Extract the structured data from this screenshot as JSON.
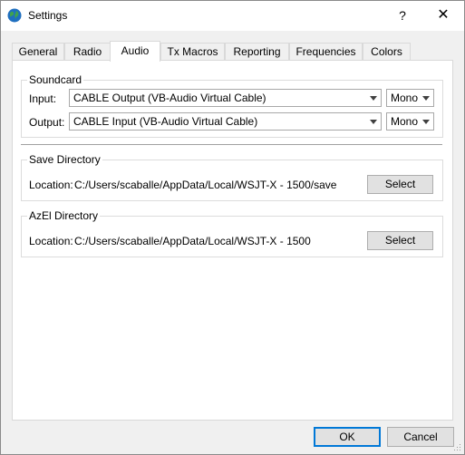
{
  "window": {
    "title": "Settings",
    "help_label": "?",
    "close_label": "✕",
    "icon": "wsjt-globe-icon"
  },
  "tabs": [
    {
      "label": "General",
      "active": false
    },
    {
      "label": "Radio",
      "active": false
    },
    {
      "label": "Audio",
      "active": true
    },
    {
      "label": "Tx Macros",
      "active": false
    },
    {
      "label": "Reporting",
      "active": false
    },
    {
      "label": "Frequencies",
      "active": false
    },
    {
      "label": "Colors",
      "active": false
    }
  ],
  "soundcard": {
    "title": "Soundcard",
    "input_label": "Input:",
    "input_device": "CABLE Output (VB-Audio Virtual Cable)",
    "input_channel": "Mono",
    "output_label": "Output:",
    "output_device": "CABLE Input (VB-Audio Virtual Cable)",
    "output_channel": "Mono"
  },
  "save_directory": {
    "title": "Save Directory",
    "location_label": "Location:",
    "path": "C:/Users/scaballe/AppData/Local/WSJT-X - 1500/save",
    "select_label": "Select"
  },
  "azel_directory": {
    "title": "AzEl Directory",
    "location_label": "Location:",
    "path": "C:/Users/scaballe/AppData/Local/WSJT-X - 1500",
    "select_label": "Select"
  },
  "buttons": {
    "ok_label": "OK",
    "cancel_label": "Cancel"
  }
}
